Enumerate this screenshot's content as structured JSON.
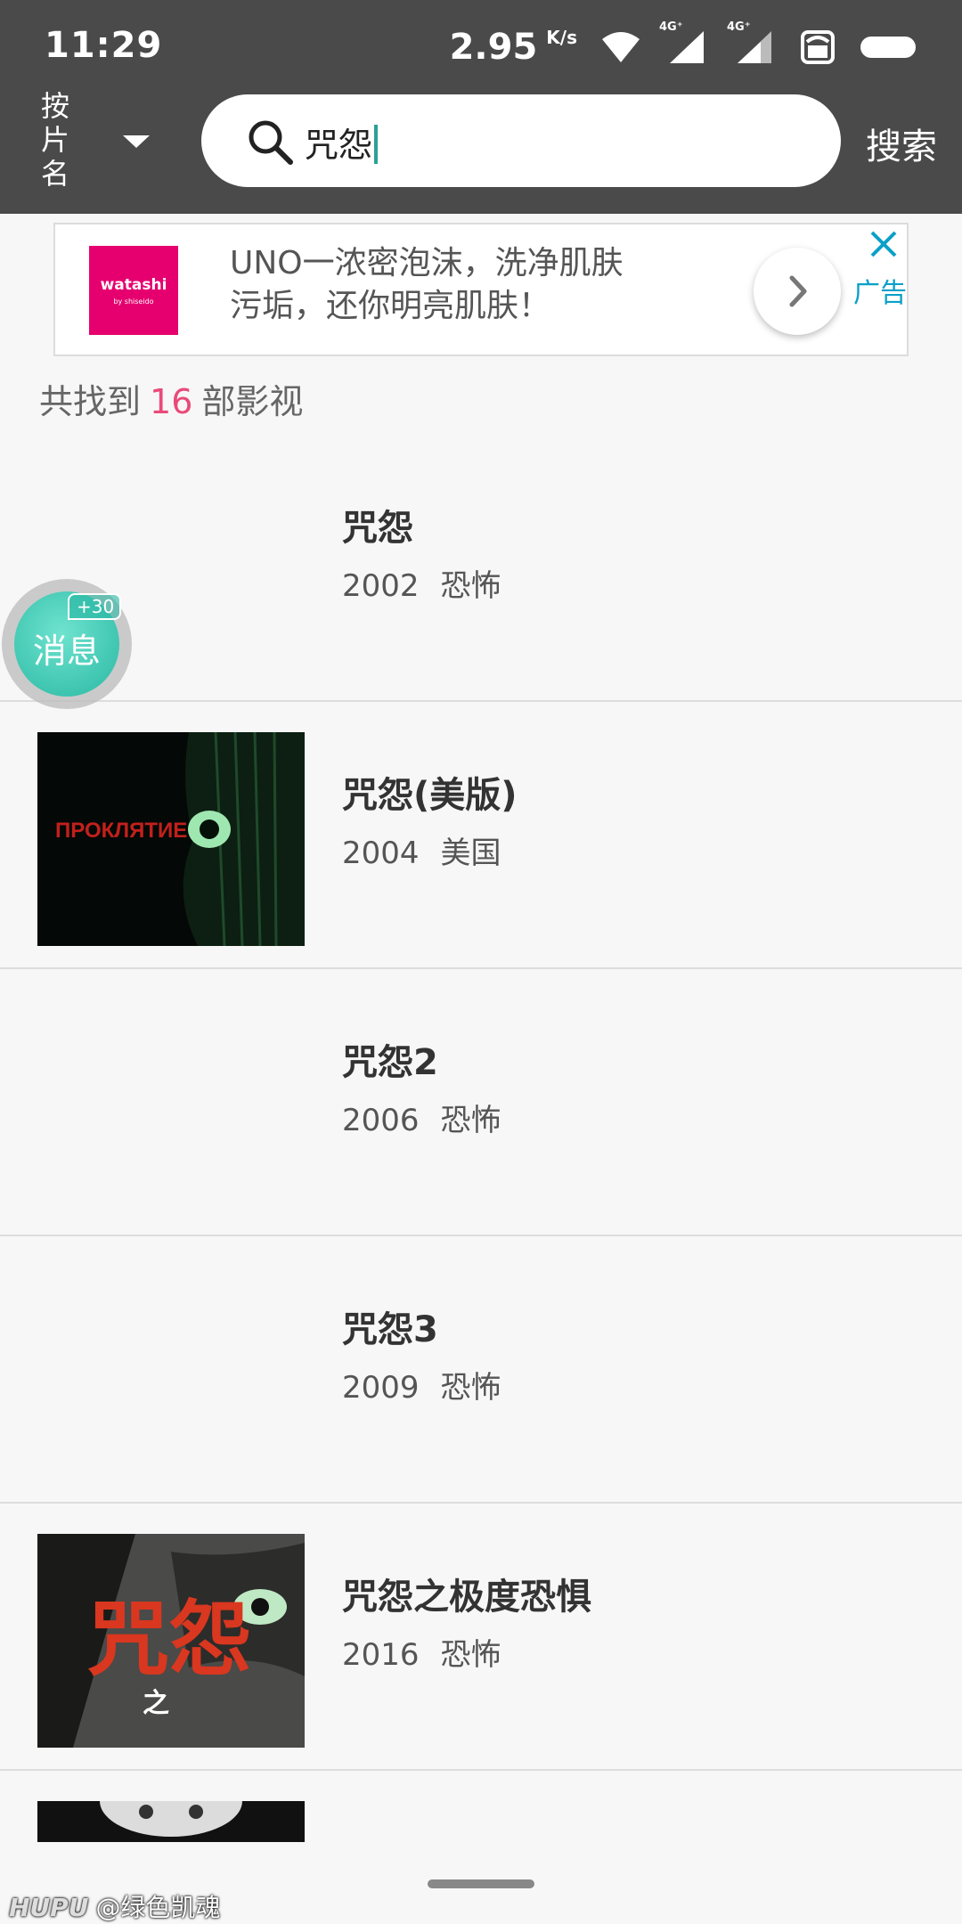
{
  "status": {
    "time": "11:29",
    "speed": "2.95",
    "speed_unit": "K/s",
    "signal1_label": "4G⁺",
    "signal2_label": "4G⁺"
  },
  "header": {
    "mode_label": "按片名",
    "search_value": "咒怨",
    "search_button": "搜索"
  },
  "ad": {
    "logo_main": "watashi",
    "logo_sub": "by shiseido",
    "text": "UNO一浓密泡沫，洗净肌肤污垢，还你明亮肌肤！",
    "tag": "广告"
  },
  "results": {
    "prefix": "共找到",
    "count": "16",
    "suffix": "部影视"
  },
  "items": [
    {
      "title": "咒怨",
      "year": "2002",
      "genre": "恐怖"
    },
    {
      "title": "咒怨(美版)",
      "year": "2004",
      "genre": "美国"
    },
    {
      "title": "咒怨2",
      "year": "2006",
      "genre": "恐怖"
    },
    {
      "title": "咒怨3",
      "year": "2009",
      "genre": "恐怖"
    },
    {
      "title": "咒怨之极度恐惧",
      "year": "2016",
      "genre": "恐怖"
    }
  ],
  "float": {
    "label": "消息",
    "badge": "+30"
  },
  "poster2_text": "ПРОКЛЯТИЕ",
  "poster5_text": "咒怨",
  "poster5_sub": "之",
  "watermark": {
    "brand": "HUPU",
    "user": "@绿色凯魂"
  },
  "colors": {
    "header_bg": "#4a4a4a",
    "accent_pink": "#e94a7a",
    "accent_teal": "#29b8a3",
    "ad_blue": "#0aa0c8"
  }
}
